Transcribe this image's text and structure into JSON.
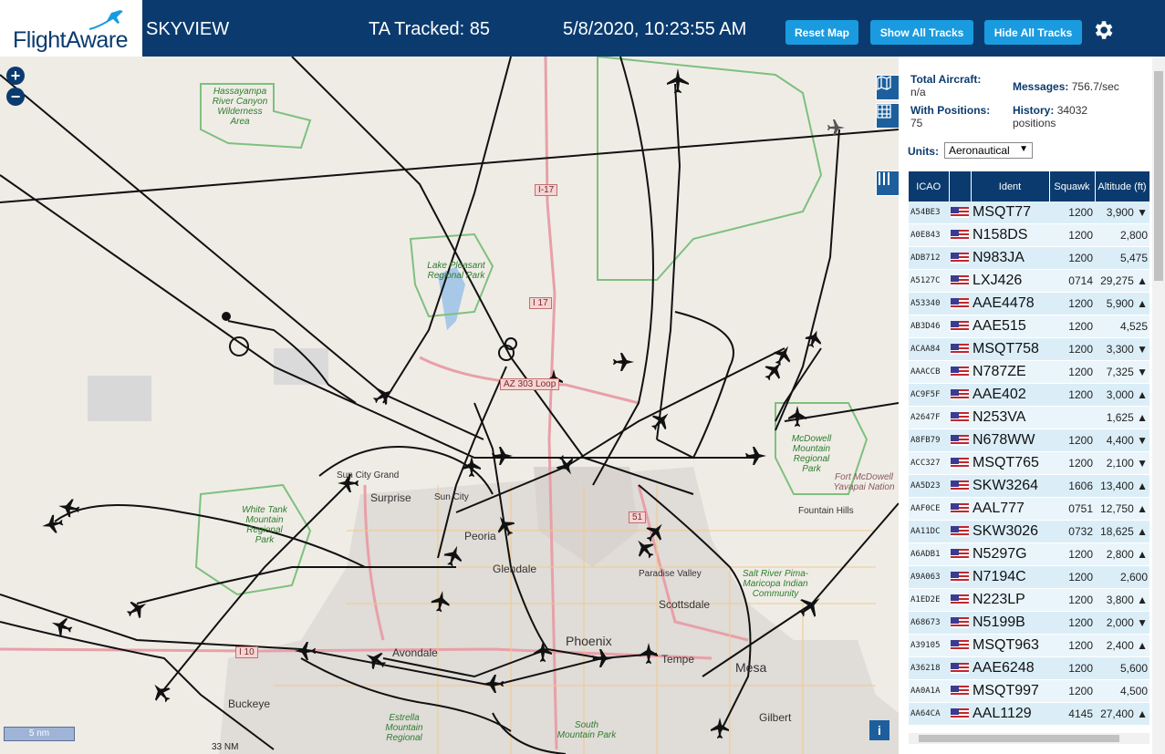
{
  "header": {
    "logo": "FlightAware",
    "brand": "SKYVIEW",
    "tracked": "TA Tracked: 85",
    "clock": "5/8/2020, 10:23:55 AM",
    "buttons": {
      "reset": "Reset Map",
      "show": "Show All Tracks",
      "hide": "Hide All Tracks"
    }
  },
  "map": {
    "scale": "5 nm",
    "scale_note": "33 NM",
    "places": [
      "Surprise",
      "Sun City Grand",
      "Sun City",
      "Peoria",
      "Glendale",
      "Paradise Valley",
      "Scottsdale",
      "Phoenix",
      "Tempe",
      "Mesa",
      "Gilbert",
      "Buckeye",
      "Avondale",
      "Fountain Hills"
    ],
    "parks": [
      "Hassayampa River Canyon Wilderness Area",
      "Lake Pleasant Regional Park",
      "White Tank Mountain Regional Park",
      "McDowell Mountain Regional Park",
      "Fort McDowell Yavapai Nation",
      "Salt River Pima-Maricopa Indian Community",
      "South Mountain Park",
      "Estrella Mountain Regional"
    ],
    "roads": [
      "I-17",
      "I 17",
      "AZ 303 Loop",
      "I 10",
      "51"
    ]
  },
  "sidebar": {
    "total_aircraft_label": "Total Aircraft:",
    "total_aircraft": "n/a",
    "with_positions_label": "With Positions:",
    "with_positions": "75",
    "messages_label": "Messages:",
    "messages": "756.7/sec",
    "history_label": "History:",
    "history": "34032 positions",
    "units_label": "Units:",
    "units_value": "Aeronautical"
  },
  "table": {
    "headers": {
      "icao": "ICAO",
      "ident": "Ident",
      "squawk": "Squawk",
      "altitude": "Altitude (ft)"
    },
    "rows": [
      {
        "icao": "A54BE3",
        "ident": "MSQT77",
        "sq": "1200",
        "alt": "3,900 ▼"
      },
      {
        "icao": "A0E843",
        "ident": "N158DS",
        "sq": "1200",
        "alt": "2,800"
      },
      {
        "icao": "ADB712",
        "ident": "N983JA",
        "sq": "1200",
        "alt": "5,475"
      },
      {
        "icao": "A5127C",
        "ident": "LXJ426",
        "sq": "0714",
        "alt": "29,275 ▲"
      },
      {
        "icao": "A53340",
        "ident": "AAE4478",
        "sq": "1200",
        "alt": "5,900 ▲"
      },
      {
        "icao": "AB3D46",
        "ident": "AAE515",
        "sq": "1200",
        "alt": "4,525"
      },
      {
        "icao": "ACAA84",
        "ident": "MSQT758",
        "sq": "1200",
        "alt": "3,300 ▼"
      },
      {
        "icao": "AAACCB",
        "ident": "N787ZE",
        "sq": "1200",
        "alt": "7,325 ▼"
      },
      {
        "icao": "AC9F5F",
        "ident": "AAE402",
        "sq": "1200",
        "alt": "3,000 ▲"
      },
      {
        "icao": "A2647F",
        "ident": "N253VA",
        "sq": "",
        "alt": "1,625 ▲"
      },
      {
        "icao": "A8FB79",
        "ident": "N678WW",
        "sq": "1200",
        "alt": "4,400 ▼"
      },
      {
        "icao": "ACC327",
        "ident": "MSQT765",
        "sq": "1200",
        "alt": "2,100 ▼"
      },
      {
        "icao": "AA5D23",
        "ident": "SKW3264",
        "sq": "1606",
        "alt": "13,400 ▲"
      },
      {
        "icao": "AAF0CE",
        "ident": "AAL777",
        "sq": "0751",
        "alt": "12,750 ▲"
      },
      {
        "icao": "AA11DC",
        "ident": "SKW3026",
        "sq": "0732",
        "alt": "18,625 ▲"
      },
      {
        "icao": "A6ADB1",
        "ident": "N5297G",
        "sq": "1200",
        "alt": "2,800 ▲"
      },
      {
        "icao": "A9A063",
        "ident": "N7194C",
        "sq": "1200",
        "alt": "2,600"
      },
      {
        "icao": "A1ED2E",
        "ident": "N223LP",
        "sq": "1200",
        "alt": "3,800 ▲"
      },
      {
        "icao": "A68673",
        "ident": "N5199B",
        "sq": "1200",
        "alt": "2,000 ▼"
      },
      {
        "icao": "A39105",
        "ident": "MSQT963",
        "sq": "1200",
        "alt": "2,400 ▲"
      },
      {
        "icao": "A36218",
        "ident": "AAE6248",
        "sq": "1200",
        "alt": "5,600"
      },
      {
        "icao": "AA0A1A",
        "ident": "MSQT997",
        "sq": "1200",
        "alt": "4,500"
      },
      {
        "icao": "AA64CA",
        "ident": "AAL1129",
        "sq": "4145",
        "alt": "27,400 ▲"
      }
    ]
  },
  "colors": {
    "header": "#0b3b6e",
    "button": "#1a9be0",
    "row_odd": "#dbeef8",
    "row_even": "#eaf5fb"
  },
  "icons": [
    "plane-logo-icon",
    "gear-icon",
    "zoom-in-icon",
    "zoom-out-icon",
    "map-layer-icon",
    "grid-icon",
    "columns-icon",
    "info-icon",
    "us-flag-icon",
    "aircraft-icon"
  ]
}
